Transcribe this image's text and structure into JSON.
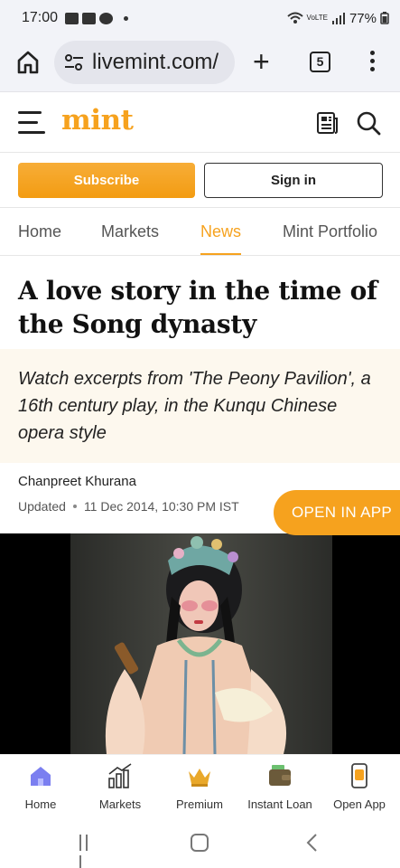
{
  "status_bar": {
    "time": "17:00",
    "network": "VoLTE",
    "battery": "77%"
  },
  "browser": {
    "url": "livemint.com/",
    "tab_count": "5"
  },
  "site": {
    "logo": "mint"
  },
  "auth": {
    "subscribe_label": "Subscribe",
    "signin_label": "Sign in"
  },
  "nav_tabs": [
    {
      "label": "Home"
    },
    {
      "label": "Markets"
    },
    {
      "label": "News",
      "active": true
    },
    {
      "label": "Mint Portfolio"
    }
  ],
  "article": {
    "headline": "A love story in the time of the Song dynasty",
    "summary": "Watch excerpts from 'The Peony Pavilion', a 16th century play, in the Kunqu Chinese opera style",
    "author": "Chanpreet Khurana",
    "updated_label": "Updated",
    "updated_time": "11 Dec 2014, 10:30 PM IST",
    "open_in_app_label": "OPEN IN APP"
  },
  "app_nav": [
    {
      "label": "Home",
      "icon": "home-icon"
    },
    {
      "label": "Markets",
      "icon": "markets-chart-icon"
    },
    {
      "label": "Premium",
      "icon": "crown-icon"
    },
    {
      "label": "Instant Loan",
      "icon": "wallet-icon"
    },
    {
      "label": "Open App",
      "icon": "phone-app-icon"
    }
  ],
  "colors": {
    "accent": "#f6a21e",
    "summary_bg": "#fdf8ee",
    "home_icon": "#7b7ff0"
  }
}
